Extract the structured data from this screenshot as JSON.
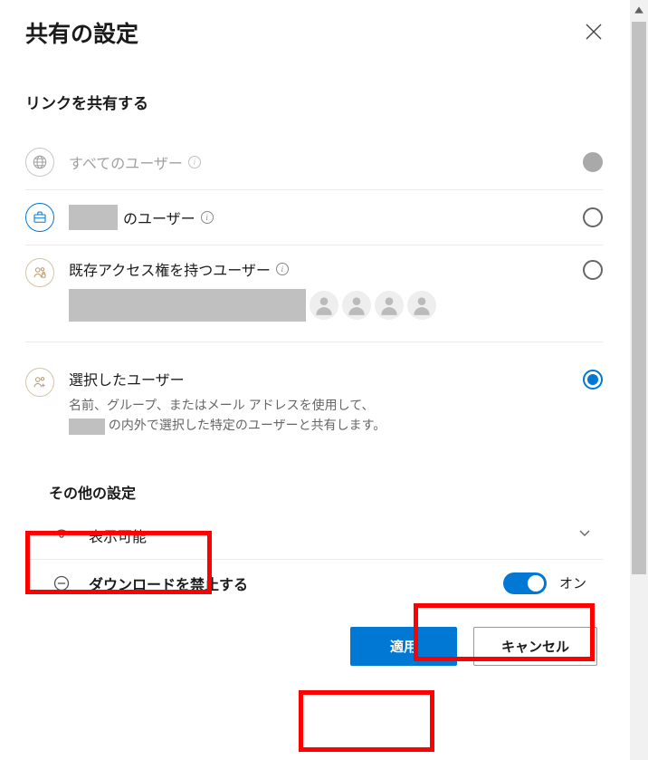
{
  "header": {
    "title": "共有の設定"
  },
  "link_section": {
    "title": "リンクを共有する",
    "options": [
      {
        "label": "すべてのユーザー",
        "selected": false,
        "disabled": true
      },
      {
        "label": "のユーザー",
        "selected": false,
        "disabled": false
      },
      {
        "label": "既存アクセス権を持つユーザー",
        "selected": false,
        "disabled": false
      },
      {
        "label": "選択したユーザー",
        "description_line1": "名前、グループ、またはメール アドレスを使用して、",
        "description_line2": "の内外で選択した特定のユーザーと共有します。",
        "selected": true,
        "disabled": false
      }
    ]
  },
  "other_settings": {
    "title": "その他の設定",
    "view_permission": "表示可能",
    "block_download": {
      "label": "ダウンロードを禁止する",
      "state_label": "オン",
      "value": true
    }
  },
  "buttons": {
    "apply": "適用",
    "cancel": "キャンセル"
  }
}
